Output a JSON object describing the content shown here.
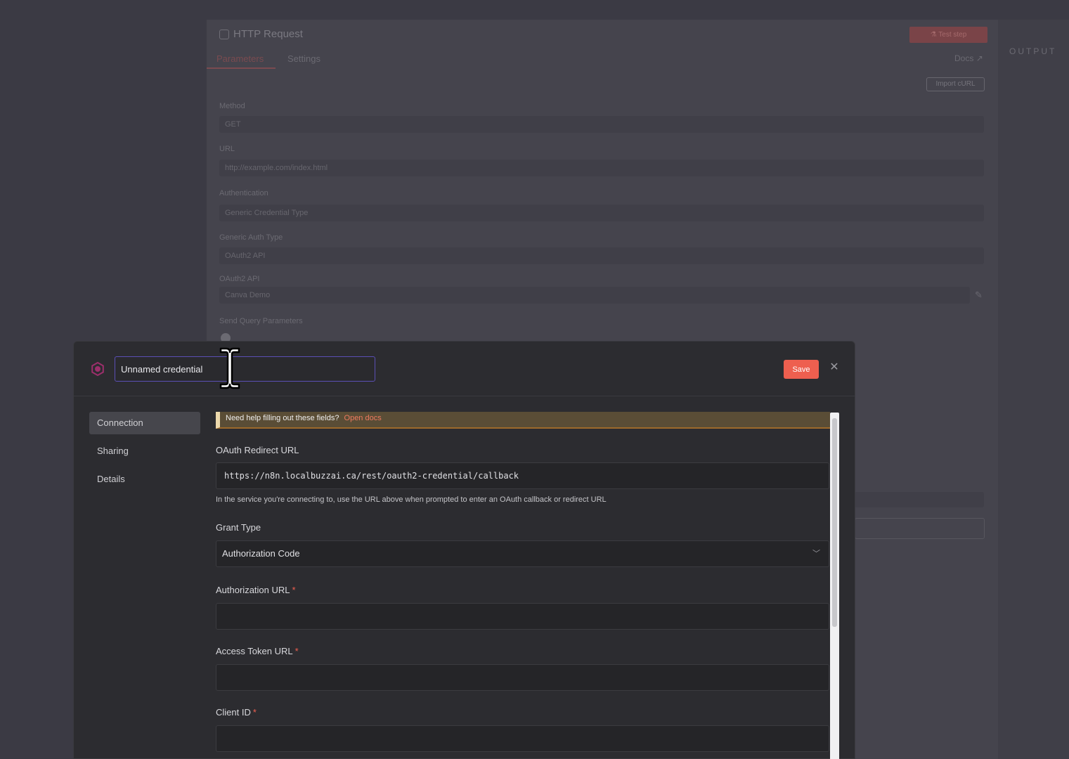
{
  "background": {
    "node_title": "HTTP Request",
    "test_button": "Test step",
    "tabs": [
      {
        "label": "Parameters"
      },
      {
        "label": "Settings"
      }
    ],
    "docs_link": "Docs",
    "import_curl": "Import cURL",
    "output_label": "OUTPUT",
    "fields": [
      {
        "label": "Method",
        "value": "GET"
      },
      {
        "label": "URL",
        "value": "http://example.com/index.html"
      },
      {
        "label": "Authentication",
        "value": "Generic Credential Type"
      },
      {
        "label": "Generic Auth Type",
        "value": "OAuth2 API"
      },
      {
        "label": "OAuth2 API",
        "value": "Canva Demo"
      },
      {
        "label": "Send Query Parameters",
        "value": ""
      }
    ]
  },
  "modal": {
    "credential_name": "Unnamed credential",
    "save_label": "Save",
    "close_icon": "close-icon",
    "sidebar": {
      "items": [
        {
          "label": "Connection",
          "active": true
        },
        {
          "label": "Sharing",
          "active": false
        },
        {
          "label": "Details",
          "active": false
        }
      ]
    },
    "help_banner": {
      "text": "Need help filling out these fields?",
      "link": "Open docs"
    },
    "redirect": {
      "label": "OAuth Redirect URL",
      "value": "https://n8n.localbuzzai.ca/rest/oauth2-credential/callback",
      "hint": "In the service you're connecting to, use the URL above when prompted to enter an OAuth callback or redirect URL"
    },
    "grant_type": {
      "label": "Grant Type",
      "value": "Authorization Code"
    },
    "authorization_url": {
      "label": "Authorization URL",
      "value": ""
    },
    "access_token_url": {
      "label": "Access Token URL",
      "value": ""
    },
    "client_id": {
      "label": "Client ID",
      "value": ""
    },
    "required_marker": "*"
  },
  "colors": {
    "accent": "#ee5f4f",
    "focus_border": "#5b4fb5",
    "banner_bg": "#5a4d36"
  }
}
